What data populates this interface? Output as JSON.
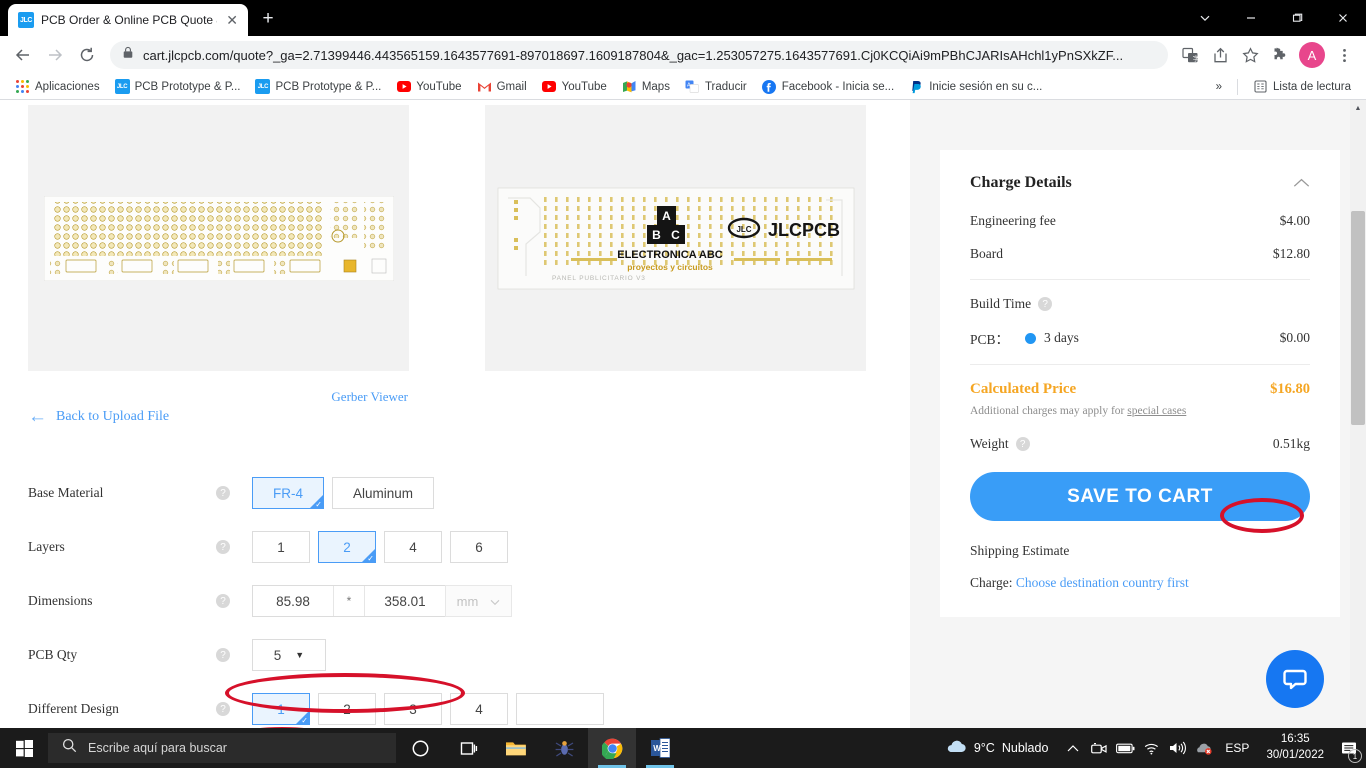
{
  "browser": {
    "tab": {
      "title": "PCB Order & Online PCB Quote &",
      "favicon_label": "JLC",
      "close_label": "✕"
    },
    "new_tab_label": "+",
    "url": "cart.jlcpcb.com/quote?_ga=2.71399446.443565159.1643577691-897018697.1609187804&_gac=1.253057275.1643577691.Cj0KCQiAi9mPBhCJARIsAHchl1yPnSXkZF...",
    "avatar_label": "A",
    "bookmarks": [
      {
        "label": "Aplicaciones",
        "icon": "apps-grid-icon"
      },
      {
        "label": "PCB Prototype & P...",
        "icon": "jlcpcb-icon"
      },
      {
        "label": "PCB Prototype & P...",
        "icon": "jlcpcb-icon"
      },
      {
        "label": "YouTube",
        "icon": "youtube-icon"
      },
      {
        "label": "Gmail",
        "icon": "gmail-icon"
      },
      {
        "label": "YouTube",
        "icon": "youtube-icon"
      },
      {
        "label": "Maps",
        "icon": "maps-icon"
      },
      {
        "label": "Traducir",
        "icon": "translate-icon"
      },
      {
        "label": "Facebook - Inicia se...",
        "icon": "facebook-icon"
      },
      {
        "label": "Inicie sesión en su c...",
        "icon": "paypal-icon"
      }
    ],
    "overflow_label": "»",
    "reading_list_label": "Lista de lectura"
  },
  "page": {
    "preview_left_alt": "PCB top view render",
    "preview_right_alt": "PCB silkscreen panel with ELECTRONICA ABC logo",
    "preview_right_text": {
      "brand": "ELECTRONICA ABC",
      "tagline": "proyectos y circuitos",
      "jlcpcb": "JLCPCB",
      "panel_note": "PANEL PUBLICITARIO V3",
      "cube_a": "A",
      "cube_b": "B",
      "cube_c": "C"
    },
    "gerber_viewer_label": "Gerber Viewer",
    "back_label": "Back to Upload File",
    "help_glyph": "?",
    "form": {
      "base_material": {
        "label": "Base Material",
        "options": [
          "FR-4",
          "Aluminum"
        ],
        "selected": "FR-4"
      },
      "layers": {
        "label": "Layers",
        "options": [
          "1",
          "2",
          "4",
          "6"
        ],
        "selected": "2"
      },
      "dimensions": {
        "label": "Dimensions",
        "width": "85.98",
        "separator": "*",
        "height": "358.01",
        "unit": "mm"
      },
      "pcb_qty": {
        "label": "PCB Qty",
        "value": "5"
      },
      "different_design": {
        "label": "Different Design",
        "options": [
          "1",
          "2",
          "3",
          "4",
          ""
        ],
        "selected": "1"
      }
    }
  },
  "charge_details": {
    "title": "Charge Details",
    "rows": [
      {
        "label": "Engineering fee",
        "value": "$4.00"
      },
      {
        "label": "Board",
        "value": "$12.80"
      }
    ],
    "build_time_label": "Build Time",
    "pcb_label": "PCB：",
    "pcb_days": "3 days",
    "pcb_price": "$0.00",
    "calculated_price_label": "Calculated Price",
    "calculated_price_value": "$16.80",
    "additional_note_prefix": "Additional charges may apply for ",
    "additional_note_link": "special cases",
    "weight_label": "Weight",
    "weight_value": "0.51kg",
    "save_to_cart_label": "SAVE TO CART",
    "shipping_estimate_label": "Shipping Estimate",
    "charge_prefix": "Charge: ",
    "charge_link": "Choose destination country first"
  },
  "chat": {
    "icon": "chat-bubble-icon"
  },
  "taskbar": {
    "search_placeholder": "Escribe aquí para buscar",
    "weather_temp": "9°C",
    "weather_desc": "Nublado",
    "language": "ESP",
    "time": "16:35",
    "date": "30/01/2022",
    "notification_count": "1"
  },
  "colors": {
    "accent_blue": "#4a9cf6",
    "price_orange": "#f5a623",
    "marker_red": "#d6112a",
    "cart_blue": "#399df7"
  }
}
